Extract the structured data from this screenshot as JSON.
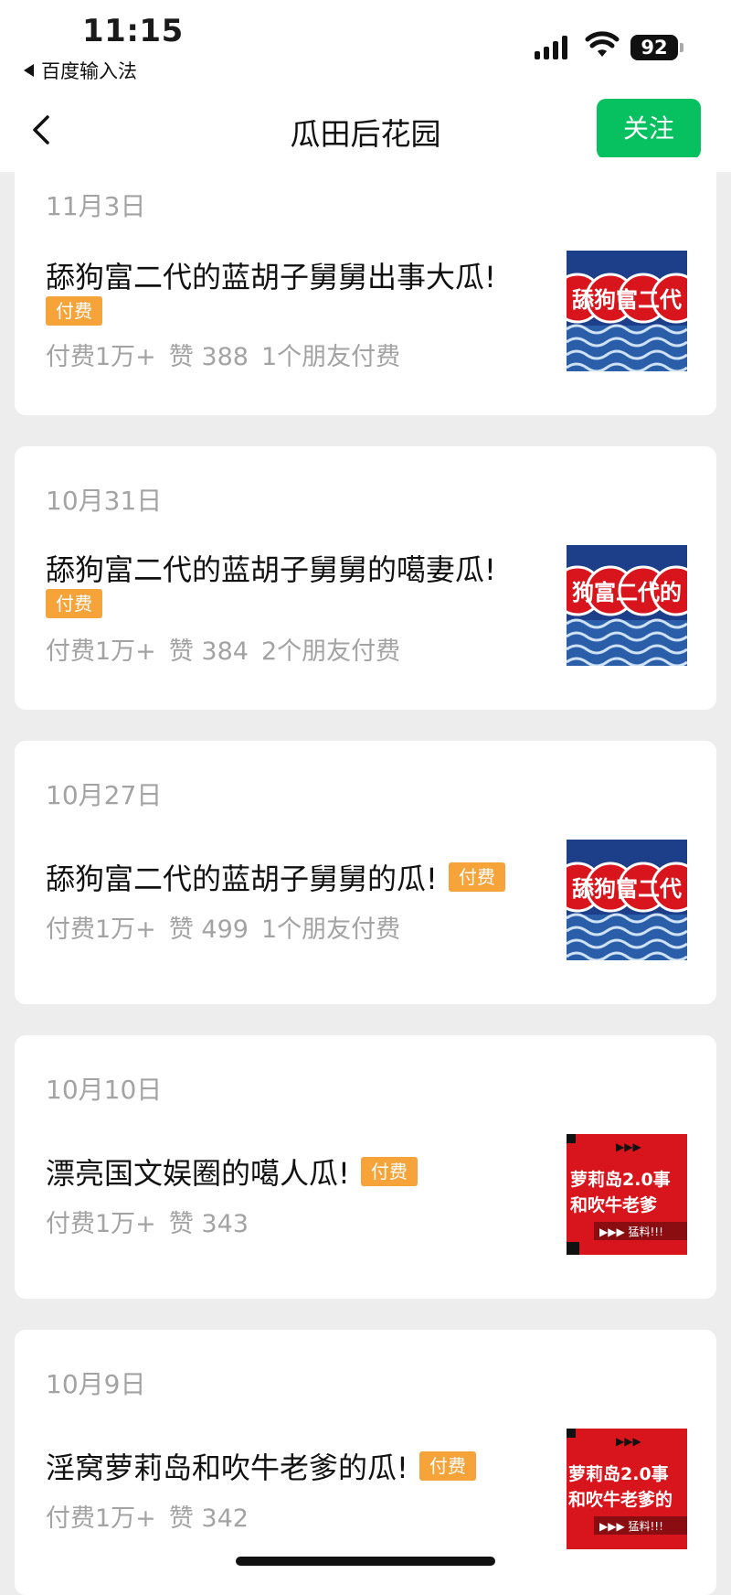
{
  "status_bar": {
    "time": "11:15",
    "back_app": "百度输入法",
    "battery": "92"
  },
  "nav": {
    "title": "瓜田后花园",
    "follow_label": "关注",
    "accent_color": "#07c160"
  },
  "articles": [
    {
      "date": "11月3日",
      "title": "舔狗富二代的蓝胡子舅舅出事大瓜!",
      "tag": "付费",
      "paid": "付费1万+",
      "likes": "赞 388",
      "friends": "1个朋友付费",
      "thumb_text": "舔狗富二代",
      "thumb_style": "blue-wave"
    },
    {
      "date": "10月31日",
      "title": "舔狗富二代的蓝胡子舅舅的噶妻瓜!",
      "tag": "付费",
      "paid": "付费1万+",
      "likes": "赞 384",
      "friends": "2个朋友付费",
      "thumb_text": "狗富二代的",
      "thumb_style": "blue-wave"
    },
    {
      "date": "10月27日",
      "title": "舔狗富二代的蓝胡子舅舅的瓜!",
      "tag": "付费",
      "paid": "付费1万+",
      "likes": "赞 499",
      "friends": "1个朋友付费",
      "thumb_text": "舔狗富二代",
      "thumb_style": "blue-wave"
    },
    {
      "date": "10月10日",
      "title": "漂亮国文娱圈的噶人瓜!",
      "tag": "付费",
      "paid": "付费1万+",
      "likes": "赞 343",
      "friends": "",
      "thumb_text": "萝莉岛2.0和吹牛老爹",
      "thumb_line1": "萝莉岛2.0事",
      "thumb_line2": "和吹牛老爹",
      "thumb_line3": "▶▶▶ 猛料!!!",
      "thumb_style": "red"
    },
    {
      "date": "10月9日",
      "title": "淫窝萝莉岛和吹牛老爹的瓜!",
      "tag": "付费",
      "paid": "付费1万+",
      "likes": "赞 342",
      "friends": "",
      "thumb_text": "萝莉岛2.0和吹牛老爹的",
      "thumb_line1": "萝莉岛2.0事",
      "thumb_line2": "和吹牛老爹的",
      "thumb_line3": "▶▶▶ 猛料!!!",
      "thumb_style": "red"
    }
  ],
  "colors": {
    "tag_bg": "#f6a33a",
    "thumb_blue": "#1d3f8a",
    "thumb_red": "#d8141c",
    "page_bg": "#ededed"
  }
}
